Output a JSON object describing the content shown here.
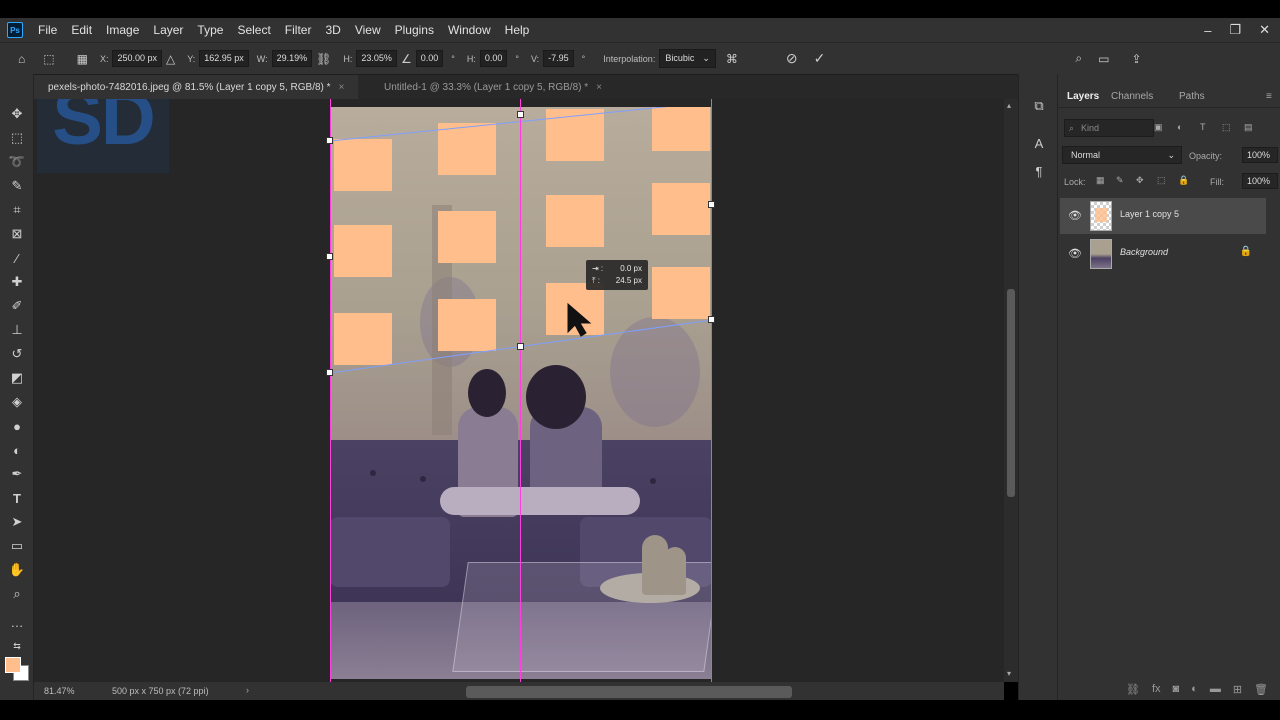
{
  "app": {
    "logo_text": "Ps",
    "menus": [
      "File",
      "Edit",
      "Image",
      "Layer",
      "Type",
      "Select",
      "Filter",
      "3D",
      "View",
      "Plugins",
      "Window",
      "Help"
    ],
    "window_controls": [
      "–",
      "❐",
      "✕"
    ]
  },
  "options_bar": {
    "x_label": "X:",
    "x_value": "250.00 px",
    "y_label": "Y:",
    "y_value": "162.95 px",
    "w_label": "W:",
    "w_value": "29.19%",
    "h_label": "H:",
    "h_value": "23.05%",
    "angle_value": "0.00",
    "angle_unit": "°",
    "hskew_label": "H:",
    "hskew_value": "0.00",
    "vskew_label": "V:",
    "vskew_value": "-7.95",
    "interp_label": "Interpolation:",
    "interp_value": "Bicubic"
  },
  "document_tabs": [
    {
      "label": "pexels-photo-7482016.jpeg @ 81.5% (Layer 1 copy 5, RGB/8) *",
      "active": true
    },
    {
      "label": "Untitled-1 @ 33.3% (Layer 1 copy 5, RGB/8) *",
      "active": false
    }
  ],
  "tab_close_glyph": "×",
  "watermark": "SD",
  "transform_readout": {
    "line1_value": "0.0 px",
    "line2_value": "24.5 px"
  },
  "status": {
    "zoom": "81.47%",
    "doc_info": "500 px x 750 px (72 ppi)",
    "arrow": "›"
  },
  "layers_panel": {
    "tabs": [
      "Layers",
      "Channels",
      "Paths"
    ],
    "kind_placeholder": "Kind",
    "blend_mode": "Normal",
    "opacity_label": "Opacity:",
    "opacity_value": "100%",
    "lock_label": "Lock:",
    "fill_label": "Fill:",
    "fill_value": "100%",
    "layers": [
      {
        "name": "Layer 1 copy 5",
        "selected": true,
        "visible": true
      },
      {
        "name": "Background",
        "selected": false,
        "visible": true,
        "locked": true
      }
    ]
  },
  "colors": {
    "foreground": "#ffbe8c",
    "background": "#ffffff",
    "guide": "#ff3de0",
    "accent": "#31a8ff"
  }
}
